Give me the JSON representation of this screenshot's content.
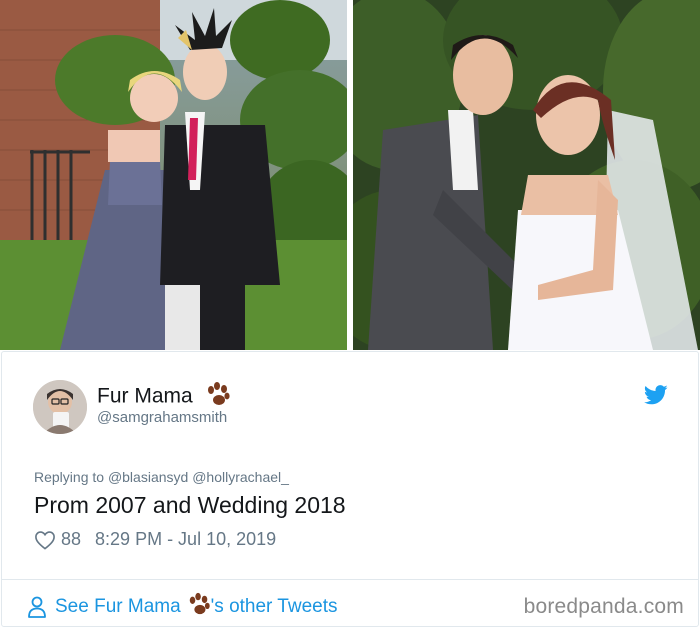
{
  "tweet": {
    "display_name": "Fur Mama",
    "handle": "@samgrahamsmith",
    "replying_prefix": "Replying to ",
    "replying_mentions": [
      "@blasiansyd",
      "@hollyrachael_"
    ],
    "text": "Prom 2007 and Wedding 2018",
    "likes": "88",
    "timestamp": "8:29 PM - Jul 10, 2019"
  },
  "footer": {
    "see_prefix": "See Fur Mama",
    "see_suffix": "'s other Tweets"
  },
  "watermark": "boredpanda.com",
  "icons": {
    "paw": "paw-emoji-icon",
    "twitter": "twitter-bird-icon",
    "heart": "heart-outline-icon",
    "person": "person-outline-icon"
  },
  "colors": {
    "twitter_blue": "#1da1f2",
    "link_blue": "#1b95e0",
    "muted_gray": "#657786",
    "paw_brown": "#7a3b1e"
  }
}
